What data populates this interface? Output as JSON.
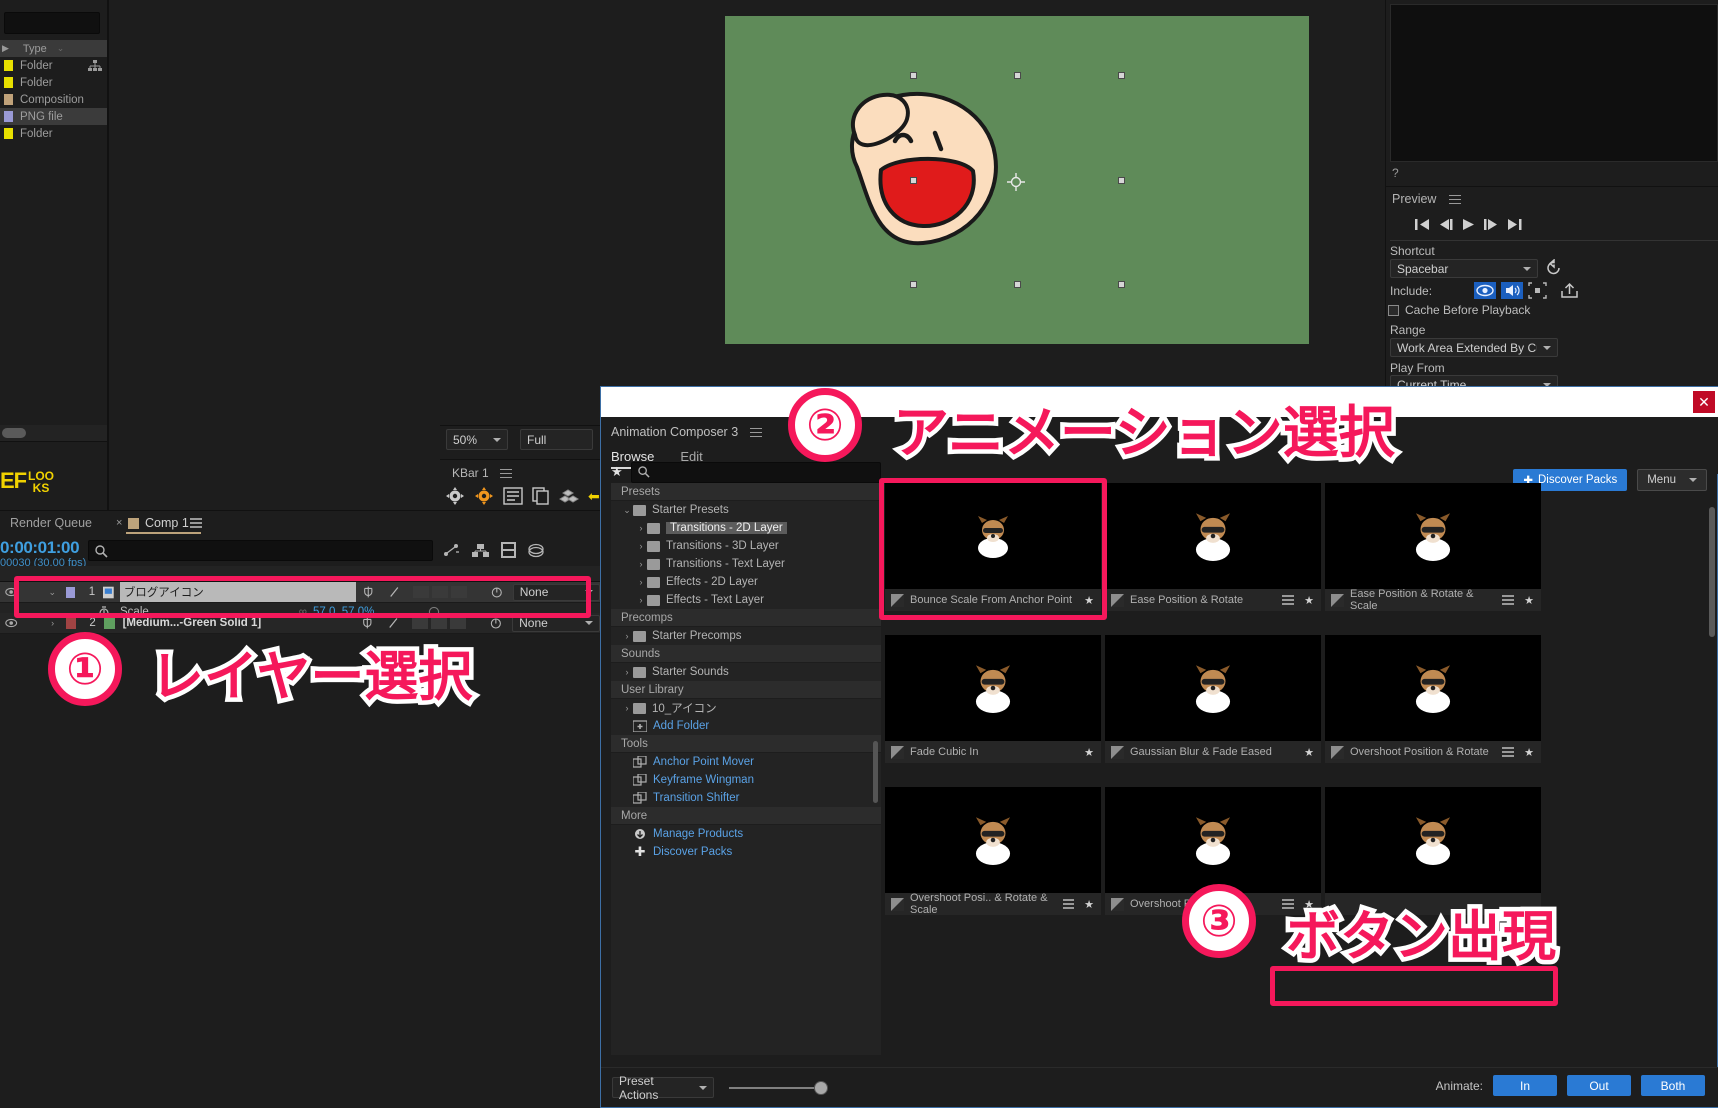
{
  "project_panel": {
    "search_placeholder": "",
    "type_header": "Type",
    "rows": [
      {
        "type": "Folder",
        "color": "#e8e000",
        "selected": false
      },
      {
        "type": "Folder",
        "color": "#e8e000",
        "selected": false
      },
      {
        "type": "Composition",
        "color": "#c0a27a",
        "selected": false
      },
      {
        "type": "PNG file",
        "color": "#9a9ad6",
        "selected": true
      },
      {
        "type": "Folder",
        "color": "#e8e000",
        "selected": false
      }
    ],
    "brand_top": "EF",
    "brand_bottom_1": "LOO",
    "brand_bottom_2": "KS"
  },
  "viewer": {
    "zoom": "50%",
    "resolution": "Full",
    "canvas_color": "#5f8b59"
  },
  "kbar": {
    "title": "KBar 1"
  },
  "preview_panel": {
    "help_glyph": "?",
    "title": "Preview",
    "shortcut_label": "Shortcut",
    "shortcut_value": "Spacebar",
    "include_label": "Include:",
    "cache_label": "Cache Before Playback",
    "range_label": "Range",
    "range_value": "Work Area Extended By Current...",
    "play_from_label": "Play From",
    "play_from_value": "Current Time"
  },
  "timeline": {
    "tab_render_queue": "Render Queue",
    "tab_comp": "Comp 1",
    "timecode": "0:00:01:00",
    "timecode_sub": "00030 (30.00 fps)",
    "search_placeholder": "",
    "layers": [
      {
        "index": "1",
        "name": "ブログアイコン",
        "label_color": "#9a9ad6",
        "parent": "None",
        "property": "Scale",
        "property_value": "57.0, 57.0%",
        "selected": true
      },
      {
        "index": "2",
        "name": "[Medium...-Green Solid 1]",
        "label_color": "#5f9f5f",
        "parent": "None",
        "selected": false
      }
    ],
    "parent_none": "None"
  },
  "animation_composer": {
    "panel_name": "Animation Composer 3",
    "tabs": [
      {
        "label": "Browse",
        "active": true
      },
      {
        "label": "Edit",
        "active": false
      }
    ],
    "search_placeholder": "",
    "discover_packs_button": "Discover Packs",
    "menu_button": "Menu",
    "tree": [
      {
        "kind": "section",
        "label": "Presets"
      },
      {
        "kind": "folder",
        "label": "Starter Presets",
        "expanded": true,
        "indent": 1
      },
      {
        "kind": "folder",
        "label": "Transitions - 2D Layer",
        "indent": 2,
        "selected": true
      },
      {
        "kind": "folder",
        "label": "Transitions - 3D Layer",
        "indent": 2
      },
      {
        "kind": "folder",
        "label": "Transitions - Text Layer",
        "indent": 2
      },
      {
        "kind": "folder",
        "label": "Effects - 2D Layer",
        "indent": 2
      },
      {
        "kind": "folder",
        "label": "Effects - Text Layer",
        "indent": 2
      },
      {
        "kind": "section",
        "label": "Precomps"
      },
      {
        "kind": "folder",
        "label": "Starter Precomps",
        "indent": 1
      },
      {
        "kind": "section",
        "label": "Sounds"
      },
      {
        "kind": "folder",
        "label": "Starter Sounds",
        "indent": 1
      },
      {
        "kind": "section",
        "label": "User Library"
      },
      {
        "kind": "folder",
        "label": "10_アイコン",
        "indent": 1
      },
      {
        "kind": "link",
        "label": "Add Folder",
        "indent": 1,
        "icon": "add-folder-icon"
      },
      {
        "kind": "section",
        "label": "Tools"
      },
      {
        "kind": "link",
        "label": "Anchor Point Mover",
        "indent": 1,
        "icon": "tool-icon"
      },
      {
        "kind": "link",
        "label": "Keyframe Wingman",
        "indent": 1,
        "icon": "tool-icon"
      },
      {
        "kind": "link",
        "label": "Transition Shifter",
        "indent": 1,
        "icon": "tool-icon"
      },
      {
        "kind": "section",
        "label": "More"
      },
      {
        "kind": "link",
        "label": "Manage Products",
        "indent": 1,
        "icon": "cloud-download-icon"
      },
      {
        "kind": "link",
        "label": "Discover Packs",
        "indent": 1,
        "icon": "plus-icon"
      }
    ],
    "presets": [
      {
        "label": "Bounce Scale From Anchor Point",
        "selected": true,
        "star": true,
        "menu": false
      },
      {
        "label": "Ease Position & Rotate",
        "selected": false,
        "star": true,
        "menu": true
      },
      {
        "label": "Ease Position & Rotate & Scale",
        "selected": false,
        "star": true,
        "menu": true
      },
      {
        "label": "Fade Cubic In",
        "selected": false,
        "star": true,
        "menu": false
      },
      {
        "label": "Gaussian Blur & Fade Eased",
        "selected": false,
        "star": true,
        "menu": false
      },
      {
        "label": "Overshoot Position & Rotate",
        "selected": false,
        "star": true,
        "menu": true
      },
      {
        "label": "Overshoot Posi.. & Rotate & Scale",
        "selected": false,
        "star": true,
        "menu": true
      },
      {
        "label": "Overshoot Rotate",
        "selected": false,
        "star": true,
        "menu": true
      },
      {
        "label": "",
        "selected": false,
        "star": false,
        "menu": false
      }
    ],
    "preset_actions": "Preset Actions",
    "animate_label": "Animate:",
    "animate_buttons": [
      "In",
      "Out",
      "Both"
    ]
  },
  "annotations": [
    {
      "num": "①",
      "text": "レイヤー選択"
    },
    {
      "num": "②",
      "text": "アニメーション選択"
    },
    {
      "num": "③",
      "text": "ボタン出現"
    }
  ],
  "colors": {
    "accent_pink": "#f5185b",
    "blue_button": "#2a7ad4",
    "link_blue": "#5aa2e6"
  }
}
